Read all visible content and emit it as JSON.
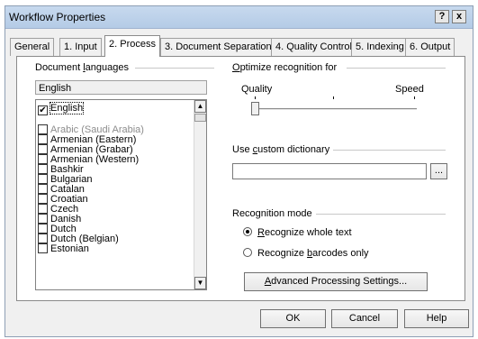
{
  "window": {
    "title": "Workflow Properties",
    "help_button": "?",
    "close_button": "x"
  },
  "tabs": [
    {
      "label": "General"
    },
    {
      "label": "1. Input"
    },
    {
      "label": "2. Process",
      "active": true
    },
    {
      "label": "3. Document Separation"
    },
    {
      "label": "4. Quality Control"
    },
    {
      "label": "5. Indexing"
    },
    {
      "label": "6. Output"
    }
  ],
  "languages": {
    "group_label_pre": "Document ",
    "group_label_key": "l",
    "group_label_post": "anguages",
    "current_value": "English",
    "items": [
      {
        "label": "English",
        "checked": true,
        "disabled": false
      },
      {
        "label": "Arabic (Saudi Arabia)",
        "checked": false,
        "disabled": true
      },
      {
        "label": "Armenian (Eastern)",
        "checked": false,
        "disabled": false
      },
      {
        "label": "Armenian (Grabar)",
        "checked": false,
        "disabled": false
      },
      {
        "label": "Armenian (Western)",
        "checked": false,
        "disabled": false
      },
      {
        "label": "Bashkir",
        "checked": false,
        "disabled": false
      },
      {
        "label": "Bulgarian",
        "checked": false,
        "disabled": false
      },
      {
        "label": "Catalan",
        "checked": false,
        "disabled": false
      },
      {
        "label": "Croatian",
        "checked": false,
        "disabled": false
      },
      {
        "label": "Czech",
        "checked": false,
        "disabled": false
      },
      {
        "label": "Danish",
        "checked": false,
        "disabled": false
      },
      {
        "label": "Dutch",
        "checked": false,
        "disabled": false
      },
      {
        "label": "Dutch (Belgian)",
        "checked": false,
        "disabled": false
      },
      {
        "label": "Estonian",
        "checked": false,
        "disabled": false
      }
    ]
  },
  "optimize": {
    "label_key": "O",
    "label_post": "ptimize recognition for",
    "quality_label": "Quality",
    "speed_label": "Speed"
  },
  "dictionary": {
    "label_pre": "Use ",
    "label_key": "c",
    "label_post": "ustom dictionary",
    "value": "",
    "browse_label": "..."
  },
  "recognition_mode": {
    "label": "Recognition mode",
    "whole_text_key": "R",
    "whole_text_post": "ecognize whole text",
    "whole_text_selected": true,
    "barcodes_pre": "Recognize ",
    "barcodes_key": "b",
    "barcodes_post": "arcodes only",
    "barcodes_selected": false
  },
  "advanced_button": {
    "key": "A",
    "post": "dvanced Processing Settings..."
  },
  "footer": {
    "ok_label": "OK",
    "cancel_label": "Cancel",
    "help_label": "Help"
  }
}
